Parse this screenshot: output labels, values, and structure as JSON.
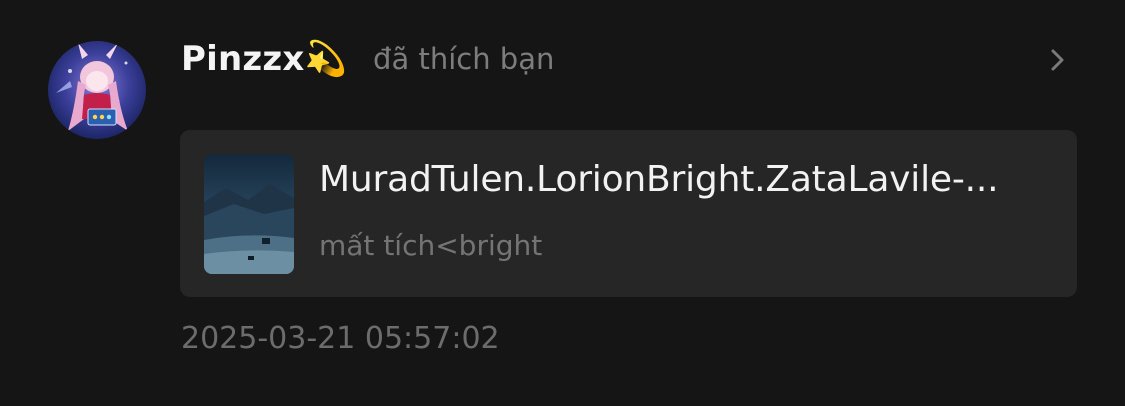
{
  "notification": {
    "username": "Pinzzx",
    "username_emoji": "💫",
    "action": "đã thích bạn",
    "timestamp": "2025-03-21 05:57:02"
  },
  "card": {
    "title": "MuradTulen.LorionBright.ZataLavile-...",
    "subtitle": "mất tích<bright"
  },
  "icons": {
    "chevron": "chevron-right-icon",
    "avatar": "avatar-anime-character",
    "thumbnail": "video-thumbnail-landscape"
  },
  "colors": {
    "background": "#151515",
    "card": "#262626",
    "username": "#f4f4f4",
    "muted": "#7d7d7d"
  }
}
